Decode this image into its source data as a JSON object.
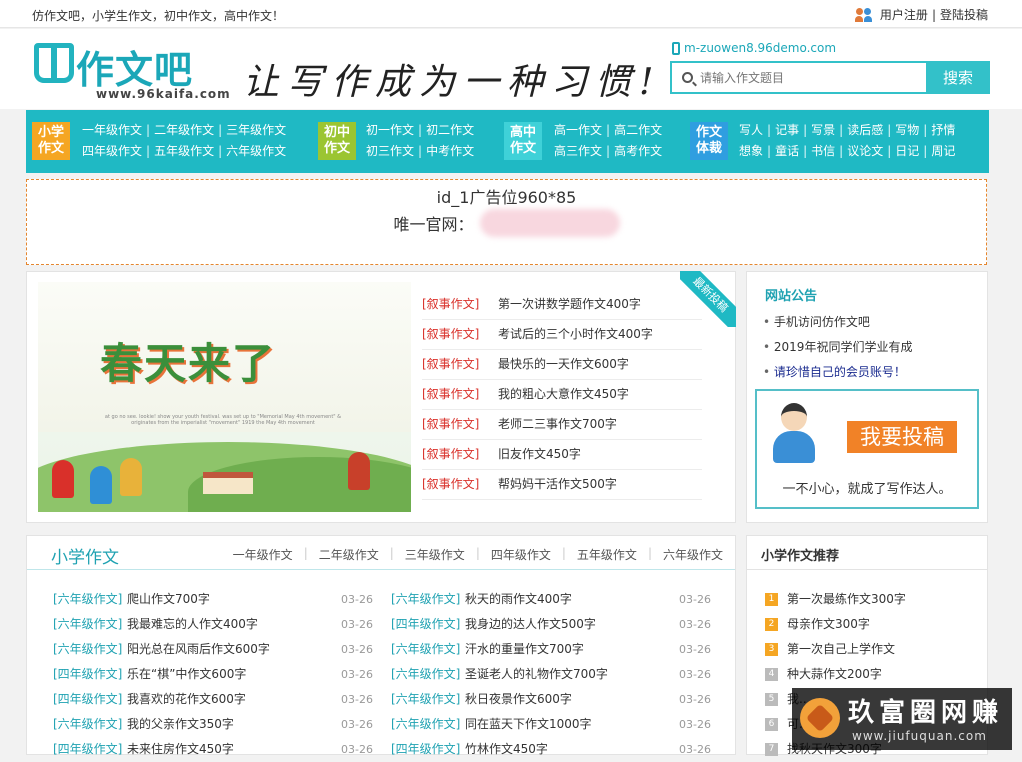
{
  "topbar": {
    "slogan": "仿作文吧，小学生作文，初中作文，高中作文！",
    "register": "用户注册",
    "separator": "|",
    "login": "登陆投稿"
  },
  "header": {
    "logo_text": "作文吧",
    "logo_url": "www.96kaifa.com",
    "tagline": "让写作成为一种习惯!",
    "mobile_link": "m-zuowen8.96demo.com",
    "search_placeholder": "请输入作文题目",
    "search_button": "搜索"
  },
  "nav": {
    "groups": [
      {
        "badge": "小学作文",
        "badge_color": "#f5a623",
        "row1": [
          "一年级作文",
          "二年级作文",
          "三年级作文"
        ],
        "row2": [
          "四年级作文",
          "五年级作文",
          "六年级作文"
        ]
      },
      {
        "badge": "初中作文",
        "badge_color": "#9bc532",
        "row1": [
          "初一作文",
          "初二作文"
        ],
        "row2": [
          "初三作文",
          "中考作文"
        ]
      },
      {
        "badge": "高中作文",
        "badge_color": "#3fd1d8",
        "row1": [
          "高一作文",
          "高二作文"
        ],
        "row2": [
          "高三作文",
          "高考作文"
        ]
      },
      {
        "badge": "作文体裁",
        "badge_color": "#2f9ee0",
        "row1": [
          "写人",
          "记事",
          "写景",
          "读后感",
          "写物",
          "抒情"
        ],
        "row2": [
          "想象",
          "童话",
          "书信",
          "议论文",
          "日记",
          "周记"
        ]
      }
    ]
  },
  "ad": {
    "line1": "id_1广告位960*85",
    "line2_label": "唯一官网："
  },
  "featured": {
    "banner_title": "春天来了",
    "banner_sub": "at go no see. lookie! show your youth festival. was set up to \"Memorial May 4th movement\" & originates from the imperialist \"movement\" 1919 the May 4th movement",
    "ribbon": "最新投稿",
    "items": [
      {
        "cat": "[叙事作文]",
        "title": "第一次讲数学题作文400字"
      },
      {
        "cat": "[叙事作文]",
        "title": "考试后的三个小时作文400字"
      },
      {
        "cat": "[叙事作文]",
        "title": "最快乐的一天作文600字"
      },
      {
        "cat": "[叙事作文]",
        "title": "我的粗心大意作文450字"
      },
      {
        "cat": "[叙事作文]",
        "title": "老师二三事作文700字"
      },
      {
        "cat": "[叙事作文]",
        "title": "旧友作文450字"
      },
      {
        "cat": "[叙事作文]",
        "title": "帮妈妈干活作文500字"
      }
    ]
  },
  "notice": {
    "title": "网站公告",
    "items": [
      "手机访问仿作文吧",
      "2019年祝同学们学业有成",
      "请珍惜自己的会员账号！"
    ],
    "contribute_button": "我要投稿",
    "contribute_tip": "一不小心，就成了写作达人。"
  },
  "xiaoxue": {
    "title": "小学作文",
    "tabs": [
      "一年级作文",
      "二年级作文",
      "三年级作文",
      "四年级作文",
      "五年级作文",
      "六年级作文"
    ],
    "left": [
      {
        "grade": "[六年级作文]",
        "title": "爬山作文700字",
        "date": "03-26"
      },
      {
        "grade": "[六年级作文]",
        "title": "我最难忘的人作文400字",
        "date": "03-26"
      },
      {
        "grade": "[六年级作文]",
        "title": "阳光总在风雨后作文600字",
        "date": "03-26"
      },
      {
        "grade": "[四年级作文]",
        "title": "乐在“棋”中作文600字",
        "date": "03-26"
      },
      {
        "grade": "[四年级作文]",
        "title": "我喜欢的花作文600字",
        "date": "03-26"
      },
      {
        "grade": "[六年级作文]",
        "title": "我的父亲作文350字",
        "date": "03-26"
      },
      {
        "grade": "[四年级作文]",
        "title": "未来住房作文450字",
        "date": "03-26"
      }
    ],
    "right": [
      {
        "grade": "[六年级作文]",
        "title": "秋天的雨作文400字",
        "date": "03-26"
      },
      {
        "grade": "[四年级作文]",
        "title": "我身边的达人作文500字",
        "date": "03-26"
      },
      {
        "grade": "[六年级作文]",
        "title": "汗水的重量作文700字",
        "date": "03-26"
      },
      {
        "grade": "[六年级作文]",
        "title": "圣诞老人的礼物作文700字",
        "date": "03-26"
      },
      {
        "grade": "[六年级作文]",
        "title": "秋日夜景作文600字",
        "date": "03-26"
      },
      {
        "grade": "[六年级作文]",
        "title": "同在蓝天下作文1000字",
        "date": "03-26"
      },
      {
        "grade": "[四年级作文]",
        "title": "竹林作文450字",
        "date": "03-26"
      }
    ]
  },
  "recommend": {
    "title": "小学作文推荐",
    "items": [
      {
        "n": "1",
        "title": "第一次最练作文300字"
      },
      {
        "n": "2",
        "title": "母亲作文300字"
      },
      {
        "n": "3",
        "title": "第一次自己上学作文"
      },
      {
        "n": "4",
        "title": "种大蒜作文200字"
      },
      {
        "n": "5",
        "title": "我..."
      },
      {
        "n": "6",
        "title": "可..."
      },
      {
        "n": "7",
        "title": "找秋天作文300字"
      }
    ]
  },
  "watermark": {
    "cn": "玖富圈网赚",
    "en": "www.jiufuquan.com"
  }
}
